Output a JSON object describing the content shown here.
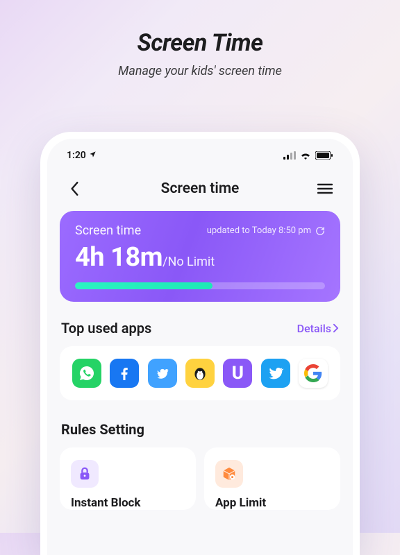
{
  "hero": {
    "title": "Screen Time",
    "subtitle": "Manage your kids' screen time"
  },
  "statusbar": {
    "time": "1:20"
  },
  "nav": {
    "title": "Screen time"
  },
  "card": {
    "label": "Screen time",
    "updated": "updated to Today 8:50 pm",
    "time_value": "4h 18m",
    "limit_text": "/No Limit",
    "progress_pct": 55
  },
  "top_used": {
    "title": "Top used apps",
    "details_label": "Details",
    "apps": [
      {
        "name": "whatsapp",
        "bg": "#25D366"
      },
      {
        "name": "facebook",
        "bg": "#1877F2"
      },
      {
        "name": "twitter-alt",
        "bg": "#40A2FF"
      },
      {
        "name": "penguin",
        "bg": "#FFD23F"
      },
      {
        "name": "u-app",
        "bg": "#8a58f7"
      },
      {
        "name": "twitter",
        "bg": "#1DA1F2"
      },
      {
        "name": "google",
        "bg": "#FFFFFF"
      }
    ]
  },
  "rules": {
    "title": "Rules Setting",
    "items": [
      {
        "icon": "lock",
        "icon_bg": "#8a58f7",
        "name": "Instant Block"
      },
      {
        "icon": "box",
        "icon_bg": "#FF8A3D",
        "name": "App Limit"
      }
    ]
  }
}
